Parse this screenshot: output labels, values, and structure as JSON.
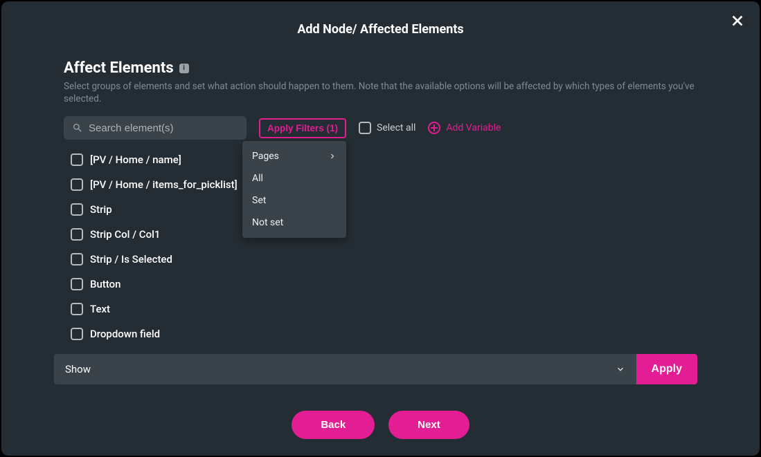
{
  "modal": {
    "title": "Add Node/ Affected Elements"
  },
  "section": {
    "title": "Affect Elements",
    "info_glyph": "i",
    "description": "Select groups of elements and set what action should happen to them. Note that the available options will be affected by which types of elements you've selected."
  },
  "search": {
    "placeholder": "Search element(s)"
  },
  "filters_button": "Apply Filters (1)",
  "select_all_label": "Select all",
  "add_variable_label": "Add Variable",
  "filter_menu": [
    {
      "label": "Pages",
      "submenu": true
    },
    {
      "label": "All",
      "submenu": false
    },
    {
      "label": "Set",
      "submenu": false
    },
    {
      "label": "Not set",
      "submenu": false
    }
  ],
  "elements": [
    "[PV / Home / name]",
    "[PV / Home / items_for_picklist]",
    "Strip",
    "Strip Col / Col1",
    "Strip / Is Selected",
    "Button",
    "Text",
    "Dropdown field"
  ],
  "action": {
    "selected": "Show",
    "apply_label": "Apply"
  },
  "footer": {
    "back": "Back",
    "next": "Next"
  }
}
